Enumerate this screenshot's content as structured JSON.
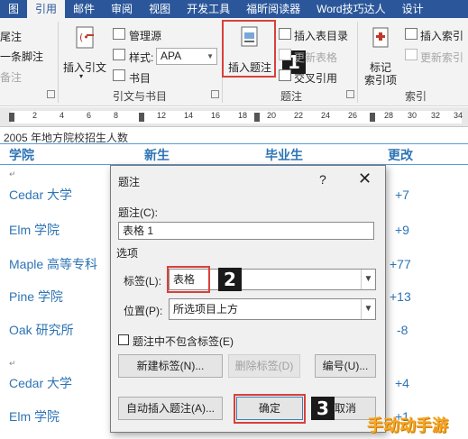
{
  "tabs": [
    "图",
    "引用",
    "邮件",
    "审阅",
    "视图",
    "开发工具",
    "福昕阅读器",
    "Word技巧达人",
    "设计"
  ],
  "ribbon": {
    "left_items": [
      "尾注",
      "一条脚注",
      "备注"
    ],
    "insert_citation_label": [
      "插入引文",
      "▾"
    ],
    "manage_sources": "管理源",
    "style_label": "样式:",
    "style_value": "APA",
    "bibliography": "书目",
    "group_citations": "引文与书目",
    "insert_caption": "插入题注",
    "insert_table_of_figures": "插入表目录",
    "update_table": "更新表格",
    "cross_reference": "交叉引用",
    "group_captions": "题注",
    "mark_entry": [
      "标记",
      "索引项"
    ],
    "insert_index": "插入索引",
    "update_index": "更新索引",
    "group_index": "索引",
    "callout1": "1",
    "callout2": "2",
    "callout3": "3"
  },
  "ruler": {
    "numbers": [
      "2",
      "4",
      "6",
      "8",
      "12",
      "14",
      "16",
      "18",
      "20",
      "22",
      "24",
      "26",
      "28",
      "30",
      "32",
      "34"
    ]
  },
  "document": {
    "title": "2005 年地方院校招生人数",
    "para_mark": "↵",
    "headers": [
      "学院",
      "新生",
      "毕业生",
      "更改"
    ],
    "rows": [
      {
        "name": "Cedar 大学",
        "change": "+7"
      },
      {
        "name": "Elm 学院",
        "change": "+9"
      },
      {
        "name": "Maple 高等专科",
        "change": "+77"
      },
      {
        "name": "Pine 学院",
        "change": "+13"
      },
      {
        "name": "Oak 研究所",
        "change": "-8"
      },
      {
        "name": "Cedar 大学",
        "change": "+4"
      },
      {
        "name": "Elm 学院",
        "change": "+1"
      }
    ]
  },
  "dialog": {
    "title": "题注",
    "help": "?",
    "close": "✕",
    "caption_label": "题注(C):",
    "caption_value": "表格 1",
    "options_label": "选项",
    "label_label": "标签(L):",
    "label_value": "表格",
    "position_label": "位置(P):",
    "position_value": "所选项目上方",
    "exclude_label": "题注中不包含标签(E)",
    "new_label_btn": "新建标签(N)...",
    "delete_label_btn": "删除标签(D)",
    "numbering_btn": "编号(U)...",
    "autocaption_btn": "自动插入题注(A)...",
    "ok_btn": "确定",
    "cancel_btn": "取消"
  },
  "watermark": "手动动手游"
}
